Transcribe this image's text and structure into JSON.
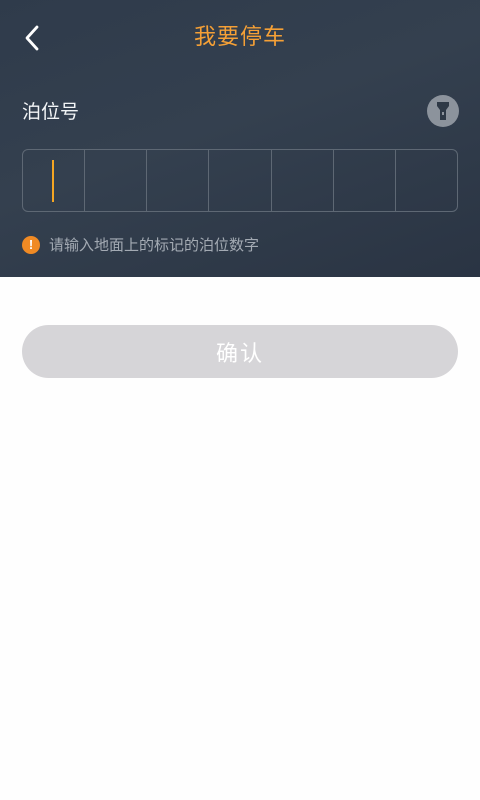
{
  "header": {
    "title": "我要停车",
    "back_icon": "chevron-left-icon",
    "title_color": "#f5a036"
  },
  "form": {
    "field_label": "泊位号",
    "flashlight_icon": "flashlight-icon",
    "digit_count": 7,
    "digits": [
      "",
      "",
      "",
      "",
      "",
      "",
      ""
    ],
    "active_index": 0,
    "cursor_color": "#f5a623",
    "hint_icon": "warning-icon",
    "hint_text": "请输入地面上的标记的泊位数字"
  },
  "actions": {
    "confirm_label": "确认",
    "confirm_enabled": false,
    "confirm_color": "#d6d5d8"
  }
}
